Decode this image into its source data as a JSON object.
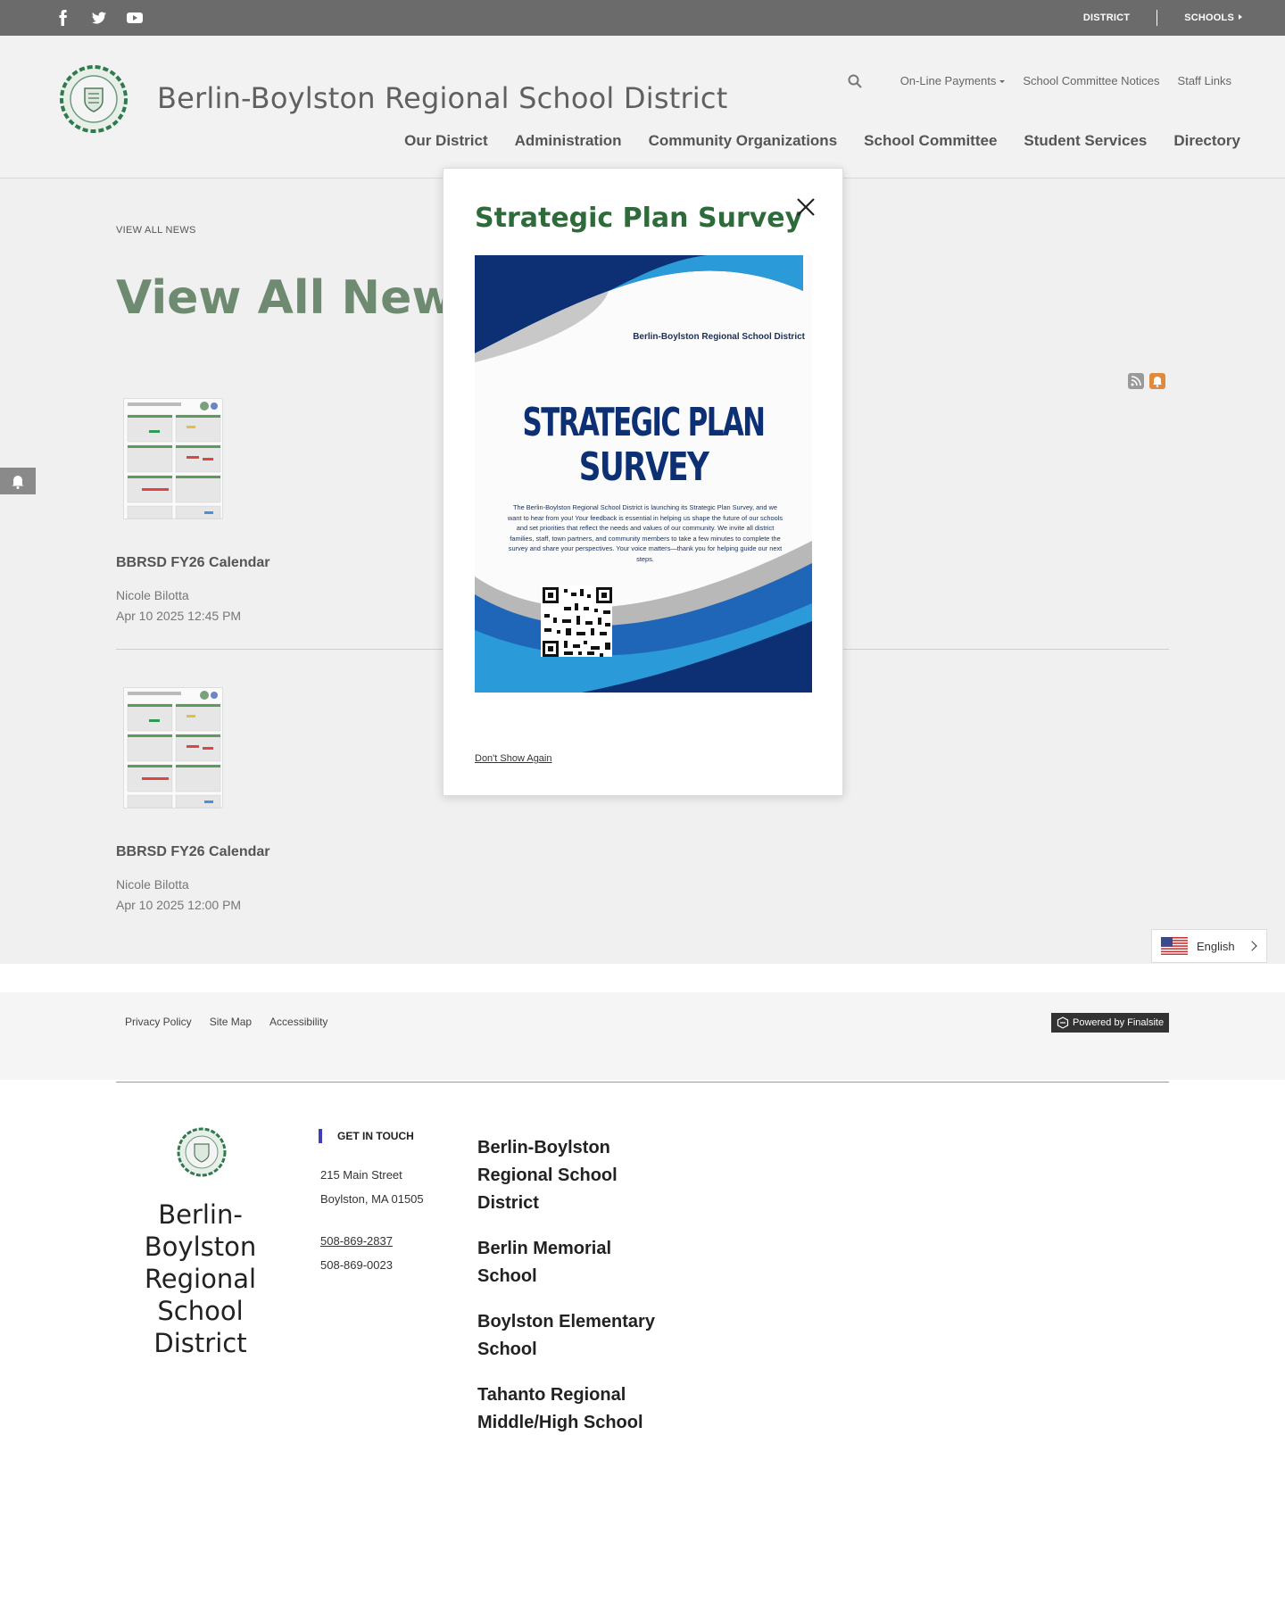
{
  "topbar": {
    "social": [
      "facebook-icon",
      "twitter-icon",
      "youtube-icon"
    ],
    "district_label": "DISTRICT",
    "schools_label": "SCHOOLS"
  },
  "header": {
    "site_title": "Berlin-Boylston Regional School District",
    "secondary_nav": [
      "On-Line Payments",
      "School Committee Notices",
      "Staff Links"
    ],
    "main_nav": [
      "Our District",
      "Administration",
      "Community Organizations",
      "School Committee",
      "Student Services",
      "Directory"
    ]
  },
  "breadcrumb": "VIEW ALL NEWS",
  "page_heading": "View All News",
  "news": [
    {
      "title": "BBRSD FY26 Calendar",
      "author": "Nicole Bilotta",
      "date": "Apr 10 2025 12:45 PM"
    },
    {
      "title": "BBRSD FY26 Calendar",
      "author": "Nicole Bilotta",
      "date": "Apr 10 2025 12:00 PM"
    }
  ],
  "language": "English",
  "footer_links": [
    "Privacy Policy",
    "Site Map",
    "Accessibility"
  ],
  "powered_by": "Powered by Finalsite",
  "footer": {
    "name": "Berlin-Boylston Regional School District",
    "get_in_touch": "GET IN TOUCH",
    "address_line1": "215 Main Street",
    "address_line2": "Boylston, MA  01505",
    "phone": "508-869-2837",
    "fax": "508-869-0023",
    "schools": [
      "Berlin-Boylston Regional School District",
      "Berlin Memorial School",
      "Boylston Elementary School",
      "Tahanto Regional Middle/High School"
    ]
  },
  "modal": {
    "title": "Strategic Plan Survey",
    "flyer_org": "Berlin-Boylston Regional School District",
    "flyer_heading_1": "STRATEGIC PLAN",
    "flyer_heading_2": "SURVEY",
    "flyer_body": "The Berlin-Boylston Regional School District is launching its Strategic Plan Survey, and we want to hear from you! Your feedback is essential in helping us shape the future of our schools and set priorities that reflect the needs and values of our community. We invite all district families, staff, town partners, and community members to take a few minutes to complete the survey and share your perspectives. Your voice matters—thank you for helping guide our next steps.",
    "dont_show": "Don't Show Again"
  },
  "colors": {
    "topbar": "#6b6b6b",
    "heading_green": "#6e8b72",
    "modal_title_green": "#2d6b3a",
    "flyer_blue": "#0d2f73",
    "accent_blue": "#3d3dbd"
  }
}
